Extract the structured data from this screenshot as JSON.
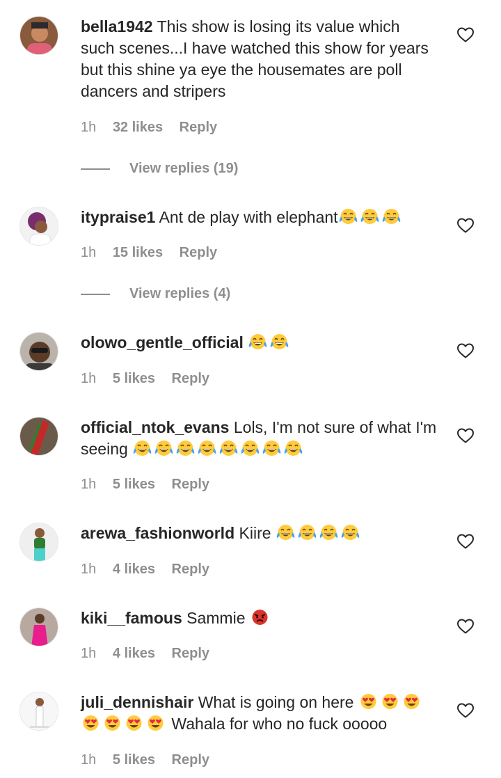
{
  "comments": [
    {
      "username": "bella1942",
      "text": "This show is losing its value which such scenes...I have watched this show for years but this shine ya eye the housemates are poll dancers and stripers",
      "time": "1h",
      "likes": "32 likes",
      "reply": "Reply",
      "view_replies": "View replies (19)",
      "avatar_icon": "profile-photo"
    },
    {
      "username": "itypraise1",
      "text": "Ant de play with elephant",
      "emojis": [
        "laughing-tears",
        "laughing-tears",
        "laughing-tears"
      ],
      "time": "1h",
      "likes": "15 likes",
      "reply": "Reply",
      "view_replies": "View replies (4)",
      "avatar_icon": "profile-photo"
    },
    {
      "username": "olowo_gentle_official",
      "text": "",
      "emojis": [
        "laughing-tears",
        "laughing-tears"
      ],
      "time": "1h",
      "likes": "5 likes",
      "reply": "Reply",
      "avatar_icon": "profile-photo"
    },
    {
      "username": "official_ntok_evans",
      "text": "Lols, I'm not sure of what I'm seeing",
      "emojis": [
        "laughing-tears",
        "laughing-tears",
        "laughing-tears",
        "laughing-tears",
        "laughing-tears",
        "laughing-tears",
        "laughing-tears",
        "laughing-tears"
      ],
      "time": "1h",
      "likes": "5 likes",
      "reply": "Reply",
      "avatar_icon": "profile-photo"
    },
    {
      "username": "arewa_fashionworld",
      "text": "Kiire",
      "emojis": [
        "laughing-tears",
        "laughing-tears",
        "laughing-tears",
        "laughing-tears"
      ],
      "time": "1h",
      "likes": "4 likes",
      "reply": "Reply",
      "avatar_icon": "profile-photo"
    },
    {
      "username": "kiki__famous",
      "text": "Sammie",
      "emojis": [
        "angry-face"
      ],
      "time": "1h",
      "likes": "4 likes",
      "reply": "Reply",
      "avatar_icon": "profile-photo"
    },
    {
      "username": "juli_dennishair",
      "text": "What is going on here",
      "emojis": [
        "heart-eyes",
        "heart-eyes",
        "heart-eyes",
        "heart-eyes",
        "heart-eyes",
        "heart-eyes",
        "heart-eyes"
      ],
      "text2": "Wahala for who no fuck ooooo",
      "time": "1h",
      "likes": "5 likes",
      "reply": "Reply",
      "avatar_icon": "profile-photo"
    }
  ],
  "icons": {
    "like": "heart-outline-icon"
  },
  "colors": {
    "text": "#262626",
    "muted": "#8e8e8e",
    "emoji_yellow": "#ffcb3d",
    "tear_blue": "#4aa3e8",
    "angry_red": "#d9342b",
    "heart_red": "#e5293f"
  }
}
